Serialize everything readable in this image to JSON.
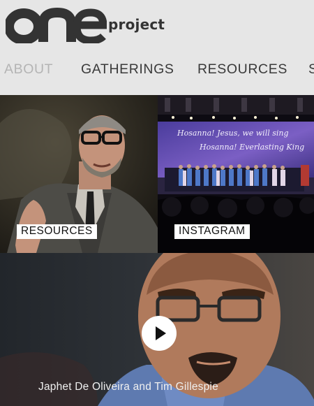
{
  "brand": {
    "logo_mark_icon": "one-logo-mark",
    "word": "project"
  },
  "nav": {
    "items": [
      {
        "label": "ABOUT",
        "state": "inactive"
      },
      {
        "label": "GATHERINGS",
        "state": "active"
      },
      {
        "label": "RESOURCES",
        "state": "active"
      },
      {
        "label": "S",
        "state": "active"
      }
    ]
  },
  "tiles": {
    "resources": {
      "label": "RESOURCES"
    },
    "instagram": {
      "label": "INSTAGRAM",
      "screen_text": [
        "Hosanna! Jesus, we will sing",
        "Hosanna! Everlasting King"
      ]
    },
    "video": {
      "caption": "Japhet De Oliveira and Tim Gillespie",
      "play_icon": "play-icon"
    }
  },
  "colors": {
    "background": "#e6e6e6",
    "logo": "#333333",
    "nav_active": "#3a3a3a",
    "nav_inactive": "#b4b4b4",
    "label_bg": "#ffffff"
  }
}
